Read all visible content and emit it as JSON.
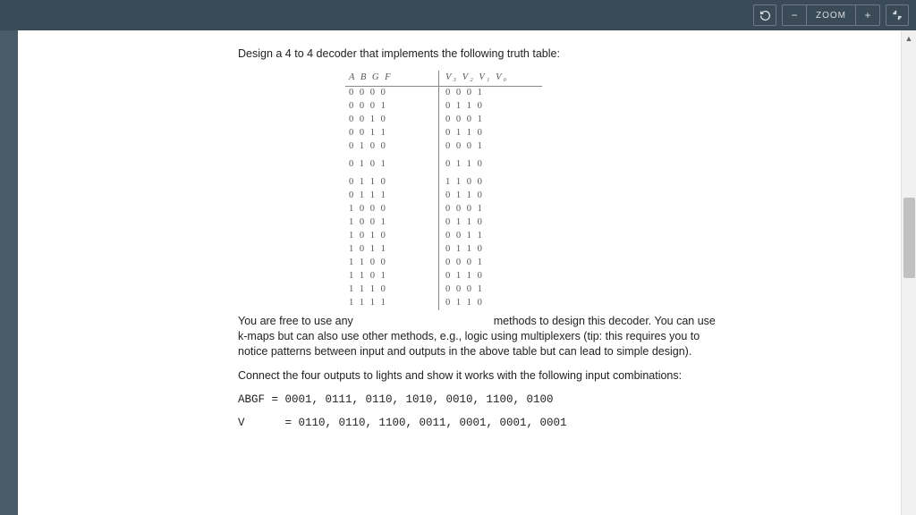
{
  "toolbar": {
    "zoom_label": "ZOOM",
    "minus": "−",
    "plus": "+"
  },
  "doc": {
    "title_line": "Design a 4 to 4 decoder that implements the following truth table:",
    "tt_header_left": "A B G F",
    "tt_header_right": "V₃ V₂ V₁ V₀",
    "tt_rows": [
      {
        "l": "0 0 0 0",
        "r": "0 0 0 1"
      },
      {
        "l": "0 0 0 1",
        "r": "0 1 1 0"
      },
      {
        "l": "0 0 1 0",
        "r": "0 0 0 1"
      },
      {
        "l": "0 0 1 1",
        "r": "0 1 1 0"
      },
      {
        "l": "0 1 0 0",
        "r": "0 0 0 1"
      },
      {
        "l": "0 1 0 1",
        "r": "0 1 1 0"
      },
      {
        "l": "0 1 1 0",
        "r": "1 1 0 0"
      },
      {
        "l": "0 1 1 1",
        "r": "0 1 1 0"
      },
      {
        "l": "1 0 0 0",
        "r": "0 0 0 1"
      },
      {
        "l": "1 0 0 1",
        "r": "0 1 1 0"
      },
      {
        "l": "1 0 1 0",
        "r": "0 0 1 1"
      },
      {
        "l": "1 0 1 1",
        "r": "0 1 1 0"
      },
      {
        "l": "1 1 0 0",
        "r": "0 0 0 1"
      },
      {
        "l": "1 1 0 1",
        "r": "0 1 1 0"
      },
      {
        "l": "1 1 1 0",
        "r": "0 0 0 1"
      },
      {
        "l": "1 1 1 1",
        "r": "0 1 1 0"
      }
    ],
    "para2a": "You are free to use any",
    "para2b": "methods to design this decoder. You can use k-maps but can also use other methods, e.g., logic using multiplexers (tip: this requires you to notice patterns between input and outputs in the above table but can lead to simple design).",
    "para3": "Connect the four outputs to lights and show it works with the following input combinations:",
    "abgf_line": "ABGF = 0001, 0111, 0110, 1010, 0010, 1100, 0100",
    "v_line": "V      = 0110, 0110, 1100, 0011, 0001, 0001, 0001"
  }
}
